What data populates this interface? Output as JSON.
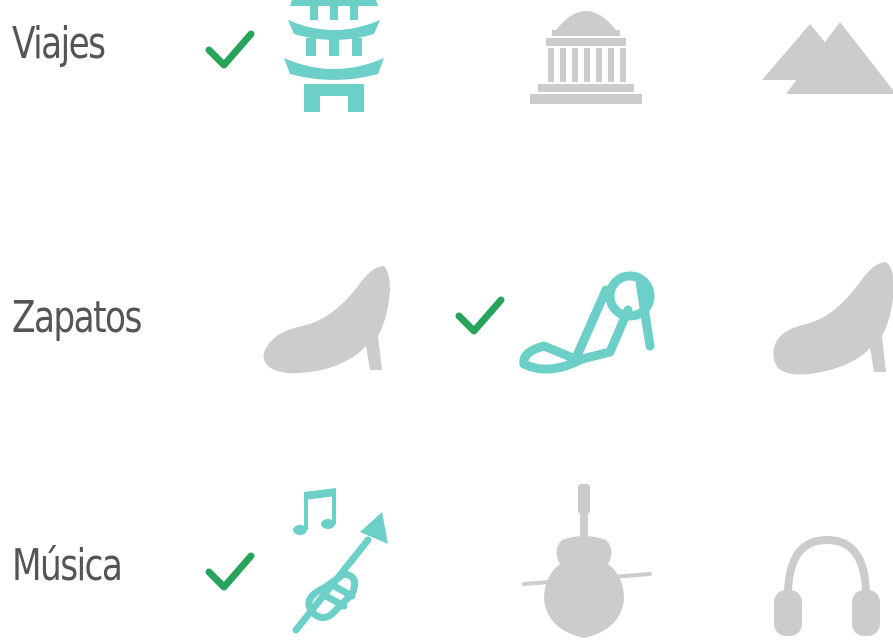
{
  "colors": {
    "selected": "#6ccfc8",
    "unselected": "#cccccc",
    "check": "#27a35a",
    "label": "#555555"
  },
  "rows": [
    {
      "label": "Viajes",
      "options": [
        {
          "icon": "pagoda-icon",
          "selected": true
        },
        {
          "icon": "capitol-building-icon",
          "selected": false
        },
        {
          "icon": "mountains-icon",
          "selected": false
        }
      ]
    },
    {
      "label": "Zapatos",
      "options": [
        {
          "icon": "high-heel-pump-icon",
          "selected": false
        },
        {
          "icon": "strappy-sandal-icon",
          "selected": true
        },
        {
          "icon": "platform-heel-icon",
          "selected": false
        }
      ]
    },
    {
      "label": "Música",
      "options": [
        {
          "icon": "trumpet-icon",
          "selected": true
        },
        {
          "icon": "double-bass-icon",
          "selected": false
        },
        {
          "icon": "headphones-icon",
          "selected": false
        }
      ]
    }
  ]
}
